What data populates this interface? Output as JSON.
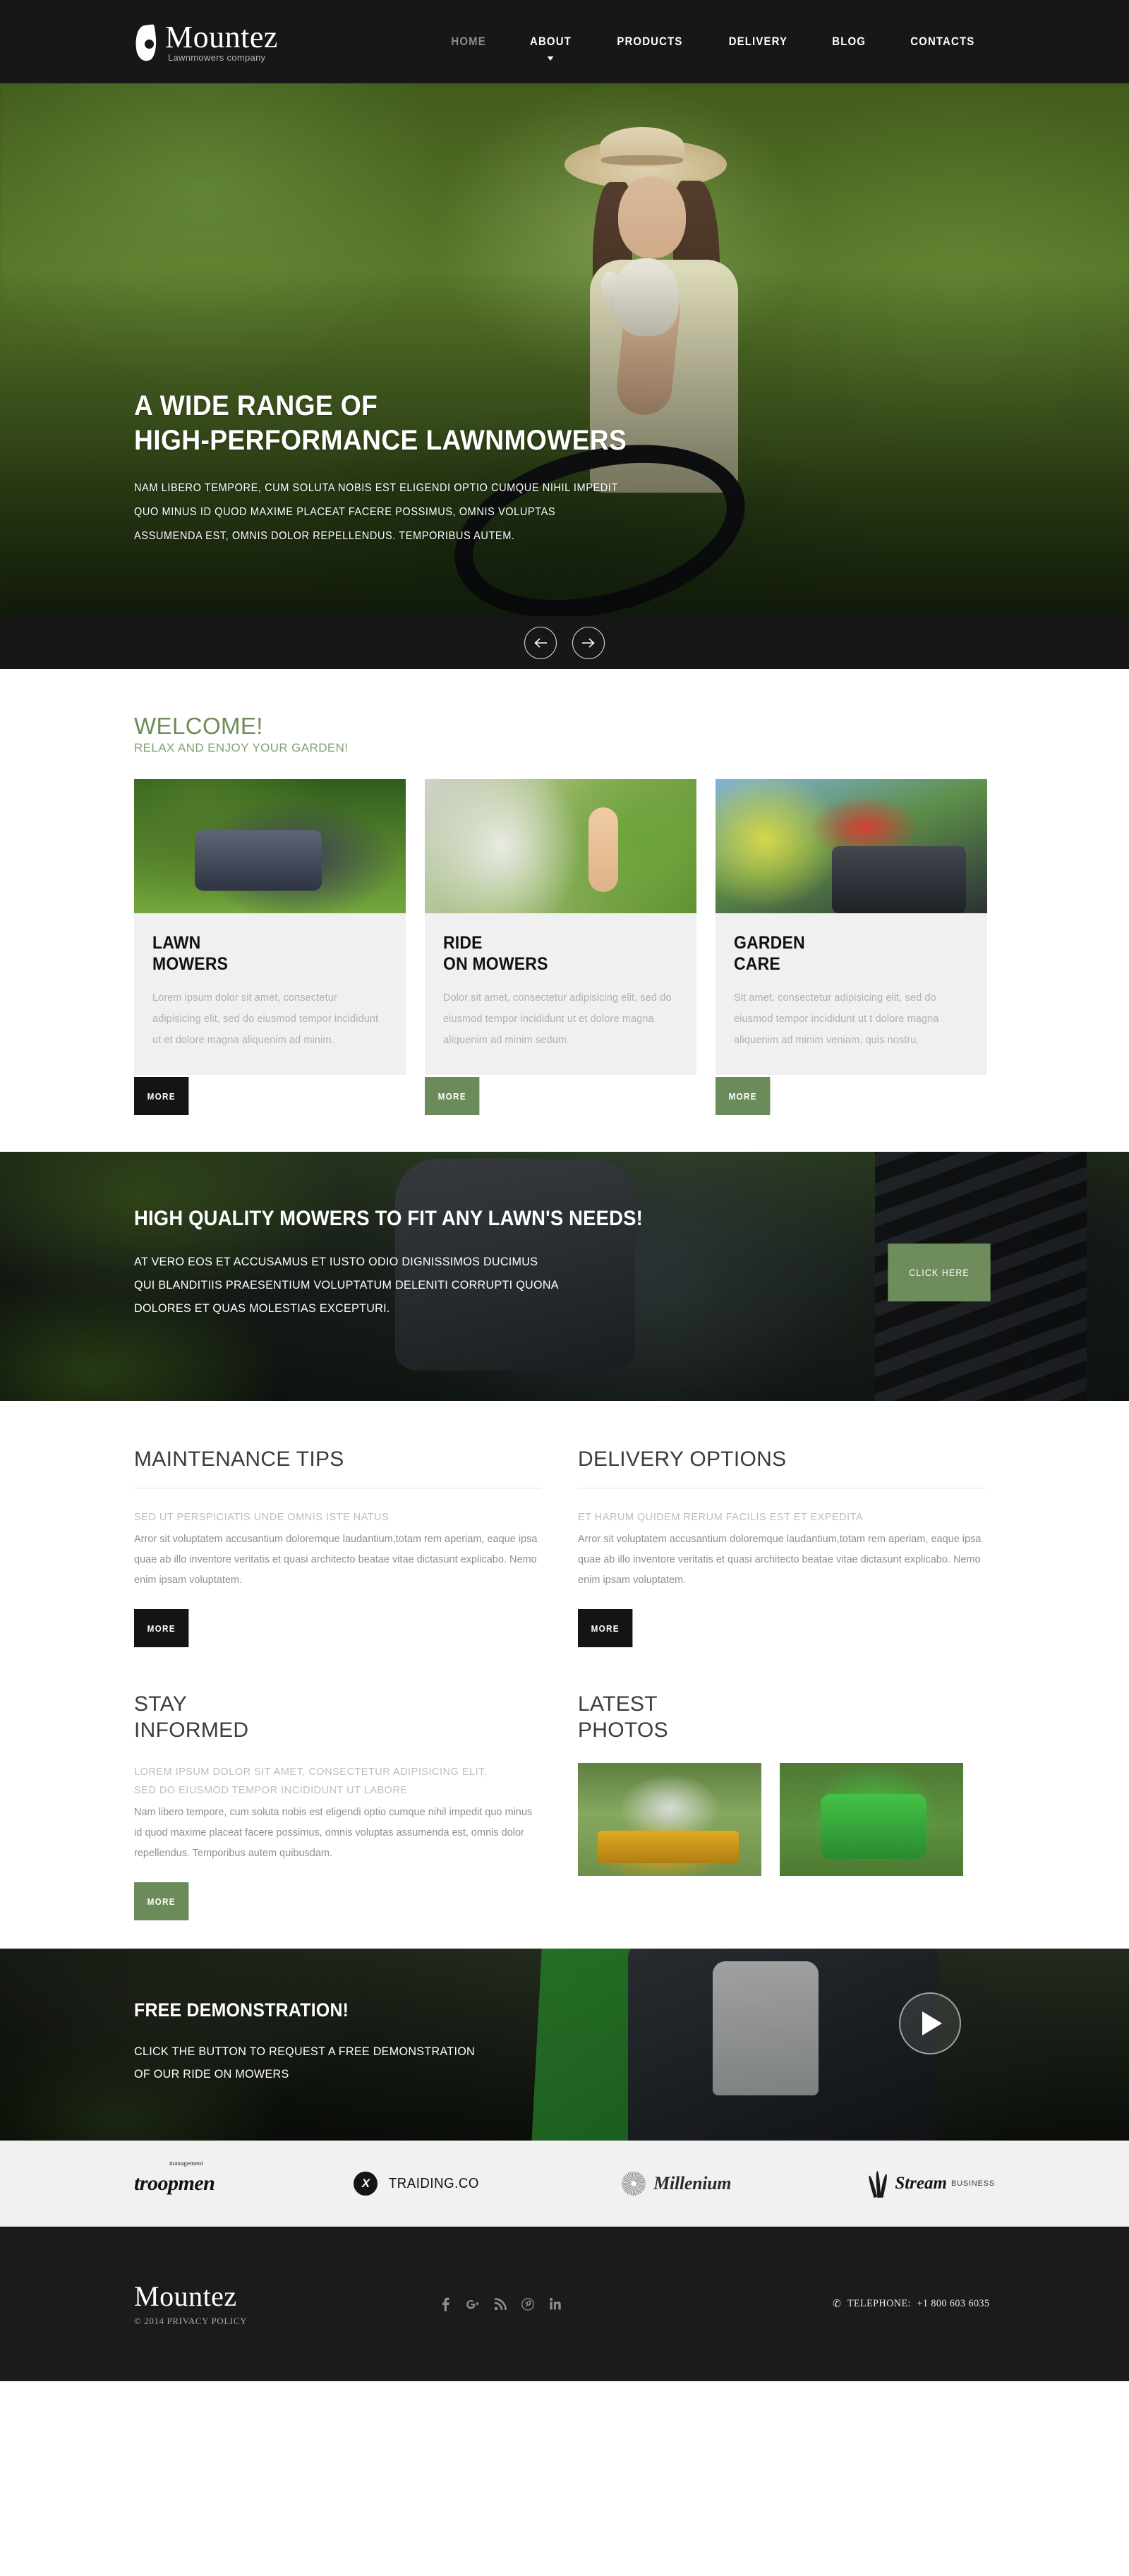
{
  "header": {
    "logo_name": "Mountez",
    "logo_tagline": "Lawnmowers company",
    "nav": [
      {
        "label": "HOME",
        "active": false
      },
      {
        "label": "ABOUT",
        "active": true
      },
      {
        "label": "PRODUCTS",
        "active": false
      },
      {
        "label": "DELIVERY",
        "active": false
      },
      {
        "label": "BLOG",
        "active": false
      },
      {
        "label": "CONTACTS",
        "active": false
      }
    ]
  },
  "hero": {
    "title_line1": "A WIDE RANGE OF",
    "title_line2": "HIGH-PERFORMANCE LAWNMOWERS",
    "text_line1": "NAM LIBERO TEMPORE, CUM SOLUTA NOBIS EST ELIGENDI OPTIO CUMQUE NIHIL IMPEDIT",
    "text_line2": "QUO MINUS ID QUOD MAXIME PLACEAT FACERE POSSIMUS, OMNIS VOLUPTAS",
    "text_line3": "ASSUMENDA EST, OMNIS DOLOR REPELLENDUS. TEMPORIBUS AUTEM.",
    "prev_icon": "arrow-left-icon",
    "next_icon": "arrow-right-icon"
  },
  "welcome": {
    "title": "WELCOME!",
    "subtitle": "RELAX AND ENJOY YOUR GARDEN!",
    "cards": [
      {
        "title": "LAWN\nMOWERS",
        "text": "Lorem ipsum dolor sit amet, consectetur adipisicing elit, sed do eiusmod tempor incididunt ut et dolore magna aliquenim ad minim.",
        "button": "MORE",
        "button_style": "dark"
      },
      {
        "title": "RIDE\nON MOWERS",
        "text": "Dolor sit amet, consectetur adipisicing elit, sed do eiusmod tempor incididunt ut et dolore magna aliquenim ad minim sedum.",
        "button": "MORE",
        "button_style": "green"
      },
      {
        "title": "GARDEN\nCARE",
        "text": "Sit amet, consectetur adipisicing elit, sed do eiusmod tempor incididunt ut t dolore magna aliquenim ad minim veniam, quis nostru.",
        "button": "MORE",
        "button_style": "green"
      }
    ]
  },
  "banner": {
    "title": "HIGH QUALITY MOWERS TO FIT ANY LAWN'S NEEDS!",
    "text_line1": "AT VERO EOS ET ACCUSAMUS ET IUSTO ODIO DIGNISSIMOS DUCIMUS",
    "text_line2": "QUI BLANDITIIS PRAESENTIUM VOLUPTATUM DELENITI CORRUPTI QUONA",
    "text_line3": "DOLORES ET QUAS MOLESTIAS EXCEPTURI.",
    "button": "CLICK HERE"
  },
  "info": {
    "maintenance": {
      "title": "MAINTENANCE TIPS",
      "lead": "SED UT PERSPICIATIS UNDE OMNIS ISTE NATUS",
      "text": "Arror sit voluptatem accusantium doloremque laudantium,totam rem aperiam, eaque ipsa quae ab illo inventore veritatis et quasi architecto beatae vitae dictasunt explicabo. Nemo enim ipsam voluptatem.",
      "button": "MORE"
    },
    "delivery": {
      "title": "DELIVERY OPTIONS",
      "lead": "ET HARUM QUIDEM RERUM FACILIS EST ET EXPEDITA",
      "text": "Arror sit voluptatem accusantium doloremque laudantium,totam rem aperiam, eaque ipsa quae ab illo inventore veritatis et quasi architecto beatae vitae dictasunt explicabo. Nemo enim ipsam voluptatem.",
      "button": "MORE"
    },
    "stay_informed": {
      "title": "STAY\nINFORMED",
      "lead": "LOREM IPSUM DOLOR SIT AMET, CONSECTETUR ADIPISICING ELIT,\nSED DO EIUSMOD TEMPOR INCIDIDUNT UT LABORE",
      "text": "Nam libero tempore, cum soluta nobis est eligendi optio cumque nihil impedit quo minus id quod maxime placeat facere possimus, omnis voluptas assumenda est, omnis dolor repellendus. Temporibus autem quibusdam.",
      "button": "MORE"
    },
    "latest_photos": {
      "title": "LATEST\nPHOTOS",
      "photo1_alt": "yellow-ride-on-mower-photo",
      "photo2_alt": "green-push-mower-photo"
    }
  },
  "demo": {
    "title": "FREE DEMONSTRATION!",
    "text_line1": "CLICK THE BUTTON TO REQUEST A FREE DEMONSTRATION",
    "text_line2": "OF OUR RIDE ON MOWERS",
    "play_icon": "play-icon"
  },
  "partners": [
    {
      "name": "troopmen",
      "sup": "management"
    },
    {
      "name": "TRAIDING.CO",
      "mark": "X"
    },
    {
      "name": "Millenium",
      "mark": "burst"
    },
    {
      "name": "Stream",
      "suffix": "BUSINESS",
      "mark": "grass"
    }
  ],
  "footer": {
    "logo": "Mountez",
    "copyright": "© 2014  PRIVACY POLICY",
    "socials": [
      {
        "name": "facebook-icon",
        "glyph": "f"
      },
      {
        "name": "google-plus-icon",
        "glyph": "g"
      },
      {
        "name": "rss-icon",
        "glyph": "≋"
      },
      {
        "name": "pinterest-icon",
        "glyph": "P"
      },
      {
        "name": "linkedin-icon",
        "glyph": "in"
      }
    ],
    "phone_label": "TELEPHONE:",
    "phone_number": "+1 800 603 6035"
  },
  "colors": {
    "dark": "#171717",
    "green": "#6b8b5a",
    "welcome_green": "#6e8d59",
    "card_bg": "#f0f0f0",
    "partners_bg": "#f1f1f1",
    "footer_bg": "#1b1b1b"
  }
}
